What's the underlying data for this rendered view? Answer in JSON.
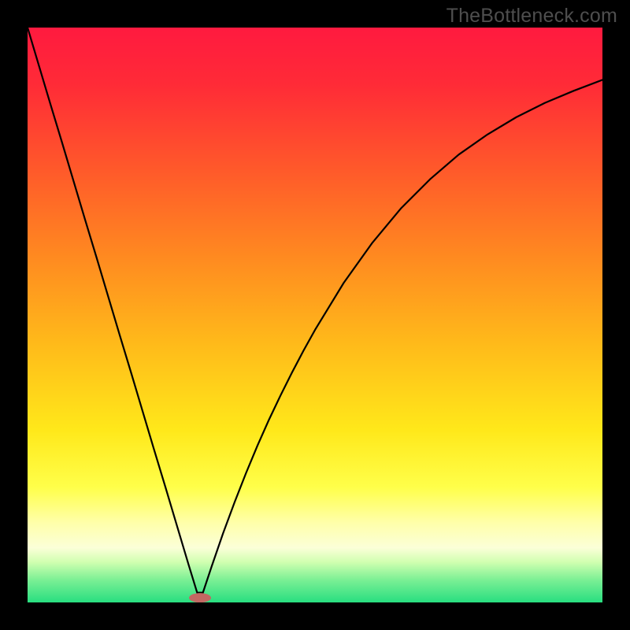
{
  "watermark": "TheBottleneck.com",
  "chart_data": {
    "type": "line",
    "title": "",
    "xlabel": "",
    "ylabel": "",
    "xlim": [
      0,
      100
    ],
    "ylim": [
      0,
      100
    ],
    "x": [
      0,
      2,
      4,
      6,
      8,
      10,
      12,
      14,
      16,
      18,
      20,
      22,
      24,
      26,
      28,
      29.5,
      30.5,
      32,
      34,
      36,
      38,
      40,
      42,
      44,
      46,
      48,
      50,
      55,
      60,
      65,
      70,
      75,
      80,
      85,
      90,
      95,
      100
    ],
    "y": [
      100,
      93.3,
      86.6,
      80.0,
      73.3,
      66.6,
      60.0,
      53.3,
      46.6,
      40.0,
      33.3,
      26.6,
      20.0,
      13.3,
      6.6,
      1.7,
      1.7,
      6.2,
      12.0,
      17.4,
      22.5,
      27.3,
      31.8,
      36.0,
      40.0,
      43.8,
      47.4,
      55.6,
      62.6,
      68.6,
      73.6,
      77.9,
      81.4,
      84.4,
      86.9,
      89.0,
      90.9
    ],
    "marker": {
      "x": 30,
      "y": 0.8,
      "color": "#c36862",
      "rx": 14,
      "ry": 6
    },
    "gradient_stops": [
      {
        "offset": 0.0,
        "color": "#ff1a3f"
      },
      {
        "offset": 0.1,
        "color": "#ff2b37"
      },
      {
        "offset": 0.25,
        "color": "#ff5a2a"
      },
      {
        "offset": 0.4,
        "color": "#ff8a20"
      },
      {
        "offset": 0.55,
        "color": "#ffba1a"
      },
      {
        "offset": 0.7,
        "color": "#ffe81a"
      },
      {
        "offset": 0.8,
        "color": "#ffff4a"
      },
      {
        "offset": 0.86,
        "color": "#ffffa8"
      },
      {
        "offset": 0.905,
        "color": "#fbffd8"
      },
      {
        "offset": 0.93,
        "color": "#d0ffb0"
      },
      {
        "offset": 0.96,
        "color": "#7df095"
      },
      {
        "offset": 1.0,
        "color": "#28de80"
      }
    ]
  }
}
